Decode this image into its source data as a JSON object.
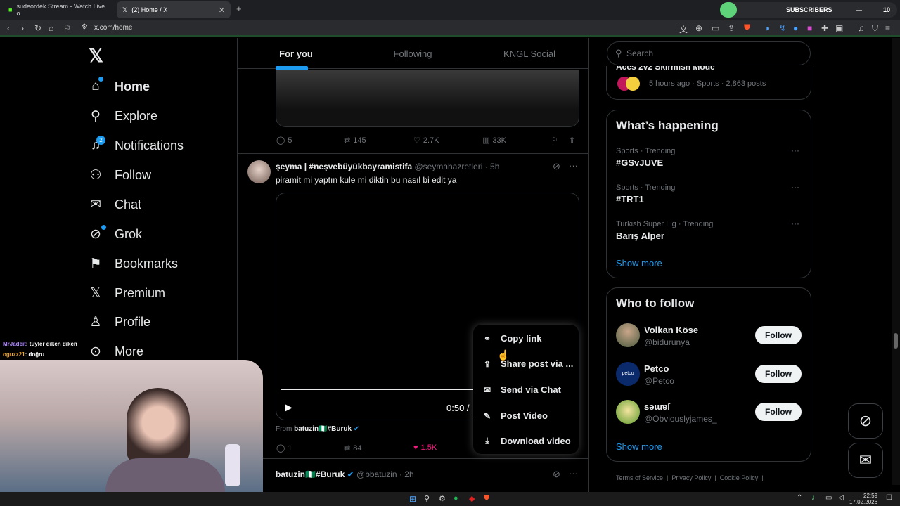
{
  "browser": {
    "tabs": [
      {
        "title": "sudeordek Stream - Watch Live o"
      },
      {
        "title": "(2) Home / X"
      }
    ],
    "url": "x.com/home",
    "subs_label": "SUBSCRIBERS",
    "subs_count": "10"
  },
  "sidebar": {
    "items": [
      {
        "label": "Home"
      },
      {
        "label": "Explore"
      },
      {
        "label": "Notifications",
        "badge": "2"
      },
      {
        "label": "Follow"
      },
      {
        "label": "Chat"
      },
      {
        "label": "Grok"
      },
      {
        "label": "Bookmarks"
      },
      {
        "label": "Premium"
      },
      {
        "label": "Profile"
      },
      {
        "label": "More"
      }
    ]
  },
  "feed": {
    "tabs": [
      "For you",
      "Following",
      "KNGL Social"
    ],
    "post1_actions": {
      "replies": "5",
      "reposts": "145",
      "likes": "2.7K",
      "views": "33K"
    },
    "post2": {
      "name": "şeyma | #neşvebüyükbayramistifa",
      "handle": "@seymahazretleri",
      "time": "· 5h",
      "text": "piramit mi yaptın kule mi diktin bu nasıl bi edit ya",
      "video_time": "0:50 /",
      "from_label": "From",
      "from_name": "batuzin🇳🇬#Buruk",
      "actions": {
        "replies": "1",
        "reposts": "84",
        "likes": "1.5K"
      }
    },
    "post3": {
      "name": "batuzin🇳🇬#Buruk",
      "handle": "@bbatuzin",
      "time": "· 2h"
    }
  },
  "context_menu": {
    "items": [
      "Copy link",
      "Share post via ...",
      "Send via Chat",
      "Post Video",
      "Download video"
    ]
  },
  "right": {
    "search_placeholder": "Search",
    "top_card": {
      "title_partial": "Aces 2v2 Skirmish Mode",
      "meta": "5 hours ago · Sports · 2,863 posts"
    },
    "trending": {
      "title": "What’s happening",
      "items": [
        {
          "meta": "Sports · Trending",
          "name": "#GSvJUVE"
        },
        {
          "meta": "Sports · Trending",
          "name": "#TRT1"
        },
        {
          "meta": "Turkish Super Lig · Trending",
          "name": "Barış Alper"
        }
      ],
      "show_more": "Show more"
    },
    "who": {
      "title": "Who to follow",
      "users": [
        {
          "name": "Volkan Köse",
          "handle": "@bidurunya"
        },
        {
          "name": "Petco",
          "handle": "@Petco"
        },
        {
          "name": "səɯɐſ",
          "handle": "@Obviouslyjames_"
        }
      ],
      "follow_label": "Follow",
      "show_more": "Show more"
    },
    "footer": [
      "Terms of Service",
      "Privacy Policy",
      "Cookie Policy"
    ]
  },
  "stream_chat": [
    {
      "user": "MrJadeit",
      "msg": ": tüyler diken diken",
      "color": "#b28cff"
    },
    {
      "user": "oguzz21",
      "msg": ": doğru",
      "color": "#f5a623"
    }
  ],
  "taskbar": {
    "time": "22:59",
    "date": "17.02.2026"
  }
}
